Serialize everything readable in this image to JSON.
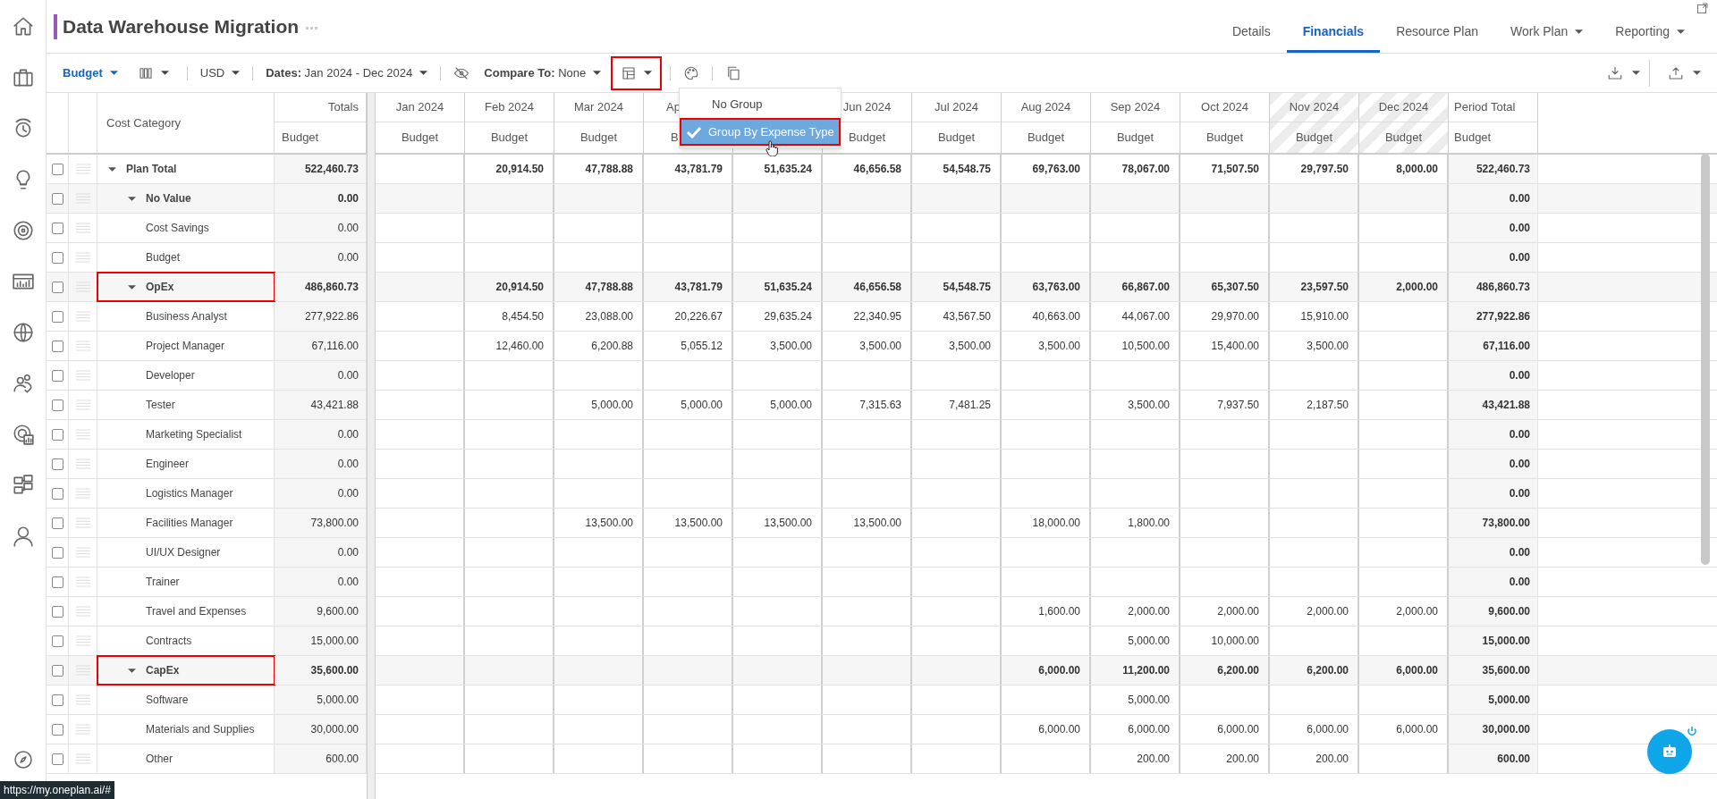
{
  "sidebar": {
    "items": [
      {
        "selected": false
      },
      {
        "selected": false
      },
      {
        "selected": false
      },
      {
        "selected": false
      },
      {
        "selected": false
      },
      {
        "selected": false
      },
      {
        "selected": false
      },
      {
        "selected": false
      },
      {
        "selected": false
      },
      {
        "selected": false
      },
      {
        "selected": false
      }
    ]
  },
  "header": {
    "title": "Data Warehouse Migration",
    "tabs": [
      {
        "label": "Details",
        "selected": false,
        "dropdown": false
      },
      {
        "label": "Financials",
        "selected": true,
        "dropdown": false
      },
      {
        "label": "Resource Plan",
        "selected": false,
        "dropdown": false
      },
      {
        "label": "Work Plan",
        "selected": false,
        "dropdown": true
      },
      {
        "label": "Reporting",
        "selected": false,
        "dropdown": true
      }
    ]
  },
  "toolbar": {
    "items": [
      {
        "kind": "view-select",
        "label": "Budget"
      },
      {
        "kind": "columns-select"
      },
      {
        "kind": "divider"
      },
      {
        "kind": "select",
        "text": "USD"
      },
      {
        "kind": "divider"
      },
      {
        "kind": "select",
        "text": "**Dates:** Jan 2024 - Dec 2024"
      },
      {
        "kind": "divider"
      },
      {
        "kind": "hide-button"
      },
      {
        "kind": "select",
        "text": "**Compare To:** None"
      },
      {
        "kind": "group-select",
        "highlighted": true
      },
      {
        "kind": "divider"
      },
      {
        "kind": "palette-button"
      },
      {
        "kind": "divider"
      },
      {
        "kind": "copy-button"
      }
    ]
  },
  "group_menu": {
    "items": [
      {
        "label": "No Group",
        "selected": false,
        "highlighted": false
      },
      {
        "label": "Group By Expense Type",
        "selected": true,
        "highlighted": true
      }
    ]
  },
  "table": {
    "columns": {
      "category": "Cost Category",
      "totals": "Totals",
      "totals_sub": "Budget",
      "months": [
        {
          "label": "Jan 2024",
          "sub": "Budget",
          "hatched": false
        },
        {
          "label": "Feb 2024",
          "sub": "Budget",
          "hatched": false
        },
        {
          "label": "Mar 2024",
          "sub": "Budget",
          "hatched": false
        },
        {
          "label": "Ap",
          "sub": "B",
          "hatched": false,
          "cut": true
        },
        {
          "hatched": false
        },
        {
          "label": "Jun 2024",
          "sub": "Budget",
          "hatched": false
        },
        {
          "label": "Jul 2024",
          "sub": "Budget",
          "hatched": false
        },
        {
          "label": "Aug 2024",
          "sub": "Budget",
          "hatched": false
        },
        {
          "label": "Sep 2024",
          "sub": "Budget",
          "hatched": false
        },
        {
          "label": "Oct 2024",
          "sub": "Budget",
          "hatched": false
        },
        {
          "label": "Nov 2024",
          "sub": "Budget",
          "hatched": true
        },
        {
          "label": "Dec 2024",
          "sub": "Budget",
          "hatched": true
        }
      ],
      "period": "Period Total",
      "period_sub": "Budget"
    },
    "rows": [
      {
        "name": "Plan Total",
        "kind": "group",
        "expanded": true,
        "checked": false,
        "highlighted": false,
        "total": "522,460.73",
        "cells": [
          {},
          {
            "value": "20,914.50"
          },
          {
            "value": "47,788.88"
          },
          {
            "value": "43,781.79"
          },
          {
            "value": "51,635.24"
          },
          {
            "value": "46,656.58"
          },
          {
            "value": "54,548.75"
          },
          {
            "value": "69,763.00"
          },
          {
            "value": "78,067.00"
          },
          {
            "value": "71,507.50"
          },
          {
            "value": "29,797.50"
          },
          {
            "value": "8,000.00"
          }
        ],
        "period_total": "522,460.73",
        "children": [
          {
            "name": "No Value",
            "kind": "group",
            "expanded": true,
            "checked": false,
            "highlighted": false,
            "total": "0.00",
            "cells": [
              {},
              {},
              {},
              {},
              {},
              {},
              {},
              {},
              {},
              {},
              {},
              {}
            ],
            "period_total": "0.00",
            "children": [
              {
                "name": "Cost Savings",
                "kind": "item",
                "checked": false,
                "total": "0.00",
                "cells": [
                  {},
                  {},
                  {},
                  {},
                  {},
                  {},
                  {},
                  {},
                  {},
                  {},
                  {},
                  {}
                ],
                "period_total": "0.00"
              },
              {
                "name": "Budget",
                "kind": "item",
                "checked": false,
                "total": "0.00",
                "cells": [
                  {},
                  {},
                  {},
                  {},
                  {},
                  {},
                  {},
                  {},
                  {},
                  {},
                  {},
                  {}
                ],
                "period_total": "0.00"
              }
            ]
          },
          {
            "name": "OpEx",
            "kind": "group",
            "expanded": true,
            "checked": false,
            "highlighted": true,
            "total": "486,860.73",
            "cells": [
              {},
              {
                "value": "20,914.50"
              },
              {
                "value": "47,788.88"
              },
              {
                "value": "43,781.79"
              },
              {
                "value": "51,635.24"
              },
              {
                "value": "46,656.58"
              },
              {
                "value": "54,548.75"
              },
              {
                "value": "63,763.00"
              },
              {
                "value": "66,867.00"
              },
              {
                "value": "65,307.50"
              },
              {
                "value": "23,597.50"
              },
              {
                "value": "2,000.00"
              }
            ],
            "period_total": "486,860.73",
            "children": [
              {
                "name": "Business Analyst",
                "kind": "item",
                "checked": false,
                "total": "277,922.86",
                "cells": [
                  {},
                  {
                    "value": "8,454.50"
                  },
                  {
                    "value": "23,088.00"
                  },
                  {
                    "value": "20,226.67"
                  },
                  {
                    "value": "29,635.24"
                  },
                  {
                    "value": "22,340.95"
                  },
                  {
                    "value": "43,567.50"
                  },
                  {
                    "value": "40,663.00"
                  },
                  {
                    "value": "44,067.00"
                  },
                  {
                    "value": "29,970.00"
                  },
                  {
                    "value": "15,910.00"
                  },
                  {}
                ],
                "period_total": "277,922.86"
              },
              {
                "name": "Project Manager",
                "kind": "item",
                "checked": false,
                "total": "67,116.00",
                "cells": [
                  {},
                  {
                    "value": "12,460.00"
                  },
                  {
                    "value": "6,200.88"
                  },
                  {
                    "value": "5,055.12"
                  },
                  {
                    "value": "3,500.00"
                  },
                  {
                    "value": "3,500.00"
                  },
                  {
                    "value": "3,500.00"
                  },
                  {
                    "value": "3,500.00"
                  },
                  {
                    "value": "10,500.00"
                  },
                  {
                    "value": "15,400.00"
                  },
                  {
                    "value": "3,500.00"
                  },
                  {}
                ],
                "period_total": "67,116.00"
              },
              {
                "name": "Developer",
                "kind": "item",
                "checked": false,
                "total": "0.00",
                "cells": [
                  {},
                  {},
                  {},
                  {},
                  {},
                  {},
                  {},
                  {},
                  {},
                  {},
                  {},
                  {}
                ],
                "period_total": "0.00"
              },
              {
                "name": "Tester",
                "kind": "item",
                "checked": false,
                "total": "43,421.88",
                "cells": [
                  {},
                  {},
                  {
                    "value": "5,000.00"
                  },
                  {
                    "value": "5,000.00"
                  },
                  {
                    "value": "5,000.00"
                  },
                  {
                    "value": "7,315.63"
                  },
                  {
                    "value": "7,481.25"
                  },
                  {},
                  {
                    "value": "3,500.00"
                  },
                  {
                    "value": "7,937.50"
                  },
                  {
                    "value": "2,187.50"
                  },
                  {}
                ],
                "period_total": "43,421.88"
              },
              {
                "name": "Marketing Specialist",
                "kind": "item",
                "checked": false,
                "total": "0.00",
                "cells": [
                  {},
                  {},
                  {},
                  {},
                  {},
                  {},
                  {},
                  {},
                  {},
                  {},
                  {},
                  {}
                ],
                "period_total": "0.00"
              },
              {
                "name": "Engineer",
                "kind": "item",
                "checked": false,
                "total": "0.00",
                "cells": [
                  {},
                  {},
                  {},
                  {},
                  {},
                  {},
                  {},
                  {},
                  {},
                  {},
                  {},
                  {}
                ],
                "period_total": "0.00"
              },
              {
                "name": "Logistics Manager",
                "kind": "item",
                "checked": false,
                "total": "0.00",
                "cells": [
                  {},
                  {},
                  {},
                  {},
                  {},
                  {},
                  {},
                  {},
                  {},
                  {},
                  {},
                  {}
                ],
                "period_total": "0.00"
              },
              {
                "name": "Facilities Manager",
                "kind": "item",
                "checked": false,
                "total": "73,800.00",
                "cells": [
                  {},
                  {},
                  {
                    "value": "13,500.00"
                  },
                  {
                    "value": "13,500.00"
                  },
                  {
                    "value": "13,500.00"
                  },
                  {
                    "value": "13,500.00"
                  },
                  {},
                  {
                    "value": "18,000.00"
                  },
                  {
                    "value": "1,800.00"
                  },
                  {},
                  {},
                  {}
                ],
                "period_total": "73,800.00"
              },
              {
                "name": "UI/UX Designer",
                "kind": "item",
                "checked": false,
                "total": "0.00",
                "cells": [
                  {},
                  {},
                  {},
                  {},
                  {},
                  {},
                  {},
                  {},
                  {},
                  {},
                  {},
                  {}
                ],
                "period_total": "0.00"
              },
              {
                "name": "Trainer",
                "kind": "item",
                "checked": false,
                "total": "0.00",
                "cells": [
                  {},
                  {},
                  {},
                  {},
                  {},
                  {},
                  {},
                  {},
                  {},
                  {},
                  {},
                  {}
                ],
                "period_total": "0.00"
              },
              {
                "name": "Travel and Expenses",
                "kind": "item",
                "checked": false,
                "total": "9,600.00",
                "cells": [
                  {},
                  {},
                  {},
                  {},
                  {},
                  {},
                  {},
                  {
                    "value": "1,600.00"
                  },
                  {
                    "value": "2,000.00"
                  },
                  {
                    "value": "2,000.00"
                  },
                  {
                    "value": "2,000.00"
                  },
                  {
                    "value": "2,000.00"
                  }
                ],
                "period_total": "9,600.00"
              },
              {
                "name": "Contracts",
                "kind": "item",
                "checked": false,
                "total": "15,000.00",
                "cells": [
                  {},
                  {},
                  {},
                  {},
                  {},
                  {},
                  {},
                  {},
                  {
                    "value": "5,000.00"
                  },
                  {
                    "value": "10,000.00"
                  },
                  {},
                  {}
                ],
                "period_total": "15,000.00"
              }
            ]
          },
          {
            "name": "CapEx",
            "kind": "group",
            "expanded": true,
            "checked": false,
            "highlighted": true,
            "total": "35,600.00",
            "cells": [
              {},
              {},
              {},
              {},
              {},
              {},
              {},
              {
                "value": "6,000.00"
              },
              {
                "value": "11,200.00"
              },
              {
                "value": "6,200.00"
              },
              {
                "value": "6,200.00"
              },
              {
                "value": "6,000.00"
              }
            ],
            "period_total": "35,600.00",
            "children": [
              {
                "name": "Software",
                "kind": "item",
                "checked": false,
                "total": "5,000.00",
                "cells": [
                  {},
                  {},
                  {},
                  {},
                  {},
                  {},
                  {},
                  {},
                  {
                    "value": "5,000.00"
                  },
                  {},
                  {},
                  {}
                ],
                "period_total": "5,000.00"
              },
              {
                "name": "Materials and Supplies",
                "kind": "item",
                "checked": false,
                "total": "30,000.00",
                "cells": [
                  {},
                  {},
                  {},
                  {},
                  {},
                  {},
                  {},
                  {
                    "value": "6,000.00"
                  },
                  {
                    "value": "6,000.00"
                  },
                  {
                    "value": "6,000.00"
                  },
                  {
                    "value": "6,000.00"
                  },
                  {
                    "value": "6,000.00"
                  }
                ],
                "period_total": "30,000.00"
              },
              {
                "name": "Other",
                "kind": "item",
                "checked": false,
                "total": "600.00",
                "cells": [
                  {},
                  {},
                  {},
                  {},
                  {},
                  {},
                  {},
                  {},
                  {
                    "value": "200.00"
                  },
                  {
                    "value": "200.00"
                  },
                  {
                    "value": "200.00"
                  },
                  {}
                ],
                "period_total": "600.00"
              }
            ]
          }
        ]
      }
    ]
  },
  "status_link": "https://my.oneplan.ai/#"
}
